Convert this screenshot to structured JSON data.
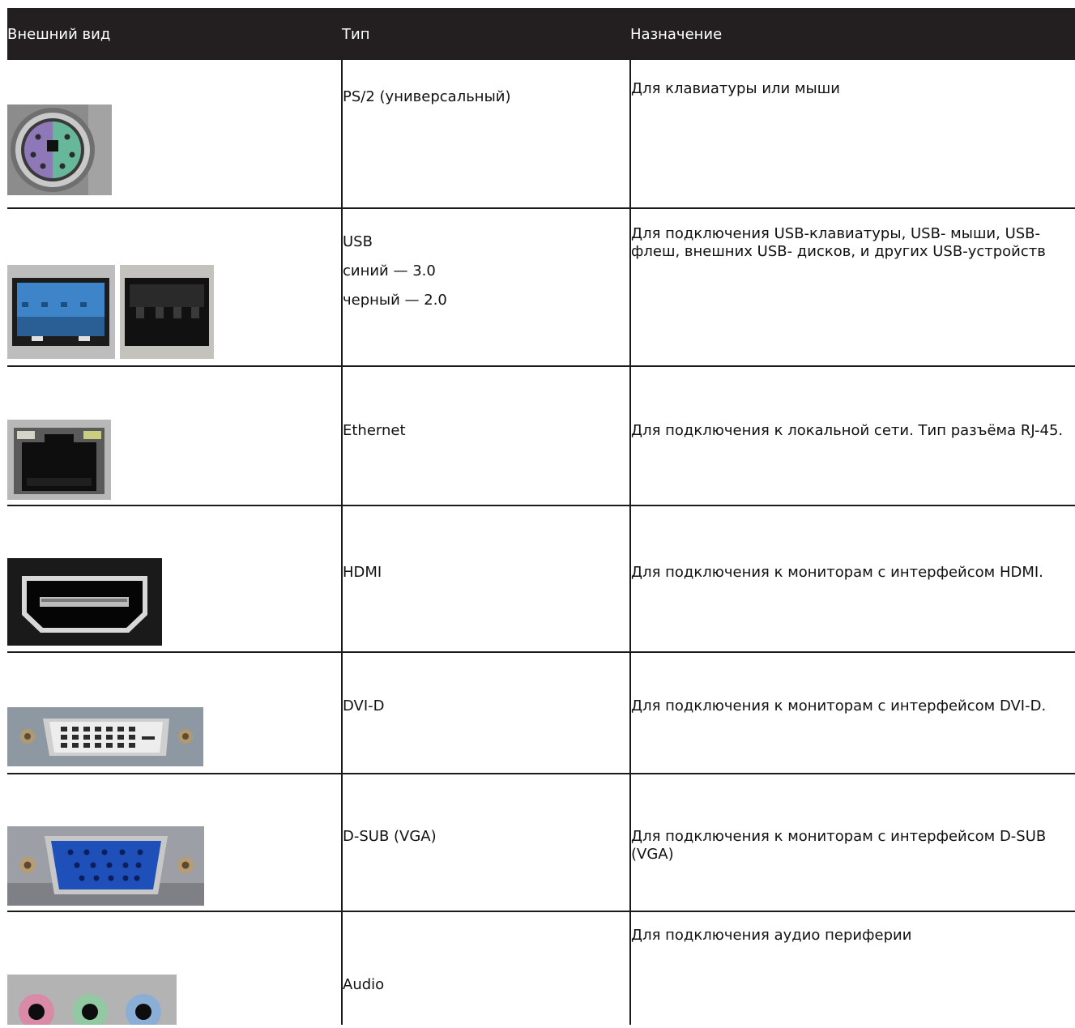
{
  "header": {
    "col_appearance": "Внешний вид",
    "col_type": "Тип",
    "col_purpose": "Назначение"
  },
  "rows": [
    {
      "type_lines": [
        "PS/2 (универсальный)"
      ],
      "purpose": "Для клавиатуры или мыши",
      "icon": "ps2-port-icon"
    },
    {
      "type_lines": [
        "USB",
        "синий — 3.0",
        "черный — 2.0"
      ],
      "purpose": "Для подключения USB-клавиатуры, USB- мыши, USB-флеш, внешних USB- дисков, и других USB-устройств",
      "icon": "usb-port-icon"
    },
    {
      "type_lines": [
        "Ethernet"
      ],
      "purpose": "Для подключения к локальной сети. Тип разъёма RJ-45.",
      "icon": "ethernet-port-icon"
    },
    {
      "type_lines": [
        "HDMI"
      ],
      "purpose": "Для подключения к мониторам с интерфейсом HDMI.",
      "icon": "hdmi-port-icon"
    },
    {
      "type_lines": [
        "DVI-D"
      ],
      "purpose": "Для подключения к мониторам с интерфейсом DVI-D.",
      "icon": "dvi-port-icon"
    },
    {
      "type_lines": [
        "D-SUB (VGA)"
      ],
      "purpose": "Для подключения к мониторам с интерфейсом D-SUB (VGA)",
      "icon": "vga-port-icon"
    },
    {
      "type_lines": [
        "Audio"
      ],
      "purpose": "Для подключения аудио периферии",
      "icon": "audio-jacks-icon"
    }
  ],
  "colors": {
    "header_bg": "#231f20",
    "header_text": "#ffffff",
    "border": "#1a1a1a"
  }
}
